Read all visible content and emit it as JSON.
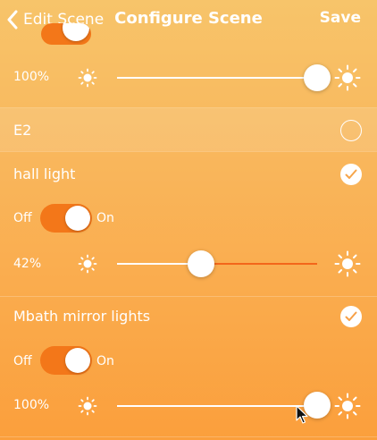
{
  "nav": {
    "back_label": "Edit Scene",
    "title": "Configure Scene",
    "save_label": "Save"
  },
  "top_slider": {
    "value_label": "100%",
    "level": 1.0
  },
  "devices": [
    {
      "name": "E2",
      "selected": false
    },
    {
      "name": "hall light",
      "selected": true,
      "toggle": {
        "off_label": "Off",
        "on_label": "On",
        "state": "on"
      },
      "brightness": {
        "value_label": "42%",
        "level": 0.42
      }
    },
    {
      "name": "Mbath mirror lights",
      "selected": true,
      "toggle": {
        "off_label": "Off",
        "on_label": "On",
        "state": "on"
      },
      "brightness": {
        "value_label": "100%",
        "level": 1.0
      }
    }
  ],
  "colors": {
    "accent": "#f37719",
    "slider_fill": "#f3661a",
    "background_top": "#f7c46a",
    "background_bottom": "#fb9f3c"
  },
  "icons": {
    "back": "chevron-left-icon",
    "brightness_low": "sun-small-icon",
    "brightness_high": "sun-large-icon",
    "selected": "checkmark-icon",
    "unselected": "empty-circle-icon",
    "cursor": "mouse-cursor-icon"
  }
}
